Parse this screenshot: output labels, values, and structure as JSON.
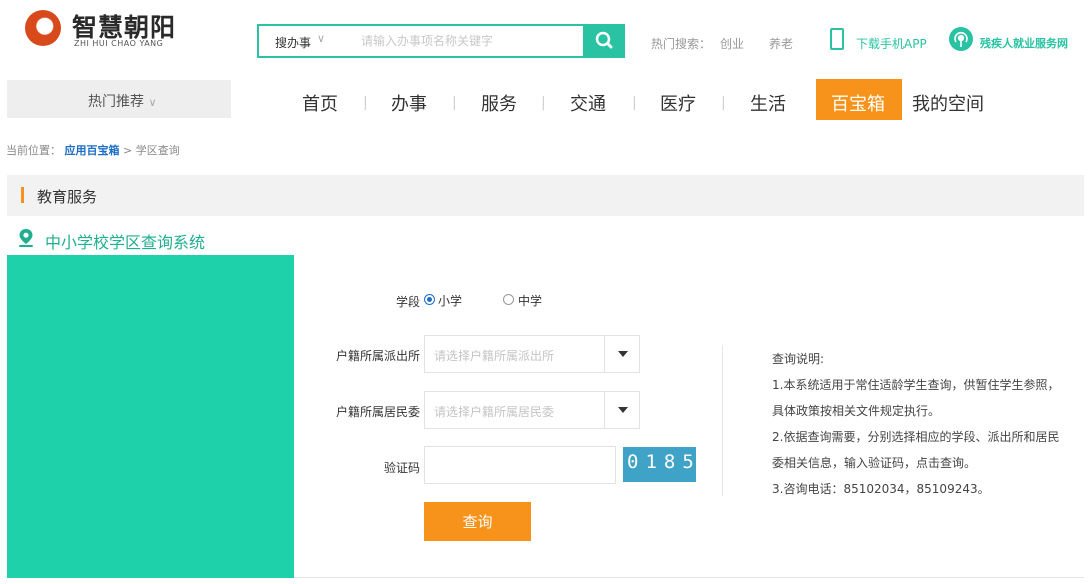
{
  "logo": {
    "title": "智慧朝阳",
    "subtitle": "ZHI HUI CHAO YANG"
  },
  "search": {
    "scope_label": "搜办事",
    "placeholder": "请输入办事项名称关键字"
  },
  "hot_search": {
    "label": "热门搜索：",
    "items": [
      "创业",
      "养老"
    ]
  },
  "header_links": {
    "app_download": "下载手机APP",
    "disability_service": "残疾人就业服务网"
  },
  "nav": {
    "recommend_label": "热门推荐",
    "items": [
      {
        "label": "首页"
      },
      {
        "label": "办事"
      },
      {
        "label": "服务"
      },
      {
        "label": "交通"
      },
      {
        "label": "医疗"
      },
      {
        "label": "生活"
      },
      {
        "label": "百宝箱"
      },
      {
        "label": "我的空间"
      }
    ],
    "active_index": 6
  },
  "breadcrumb": {
    "prefix": "当前位置：",
    "link": "应用百宝箱",
    "separator": ">",
    "current": "学区查询"
  },
  "section": {
    "title": "教育服务",
    "system_title": "中小学校学区查询系统"
  },
  "form": {
    "stage_label": "学段",
    "stage_options": [
      {
        "label": "小学",
        "checked": true
      },
      {
        "label": "中学",
        "checked": false
      }
    ],
    "police_label": "户籍所属派出所",
    "police_placeholder": "请选择户籍所属派出所",
    "committee_label": "户籍所属居民委",
    "committee_placeholder": "请选择户籍所属居民委",
    "captcha_label": "验证码",
    "captcha_value": "",
    "captcha_image_text": "0185",
    "submit_label": "查询"
  },
  "notes": {
    "title": "查询说明:",
    "lines": [
      "1.本系统适用于常住适龄学生查询，供暂住学生参照，",
      "具体政策按相关文件规定执行。",
      "2.依据查询需要，分别选择相应的学段、派出所和居民",
      "委相关信息，输入验证码，点击查询。",
      "3.咨询电话：85102034，85109243。"
    ]
  },
  "colors": {
    "teal": "#29c3a3",
    "orange": "#f7931a",
    "panel_green": "#1fd1aa",
    "link_blue": "#1e6ec6"
  },
  "icons": {
    "logo": "logo-mark",
    "search": "search-icon",
    "phone": "phone-icon",
    "service": "broadcast-icon",
    "location": "location-pin-icon",
    "dropdown": "caret-down-icon"
  }
}
